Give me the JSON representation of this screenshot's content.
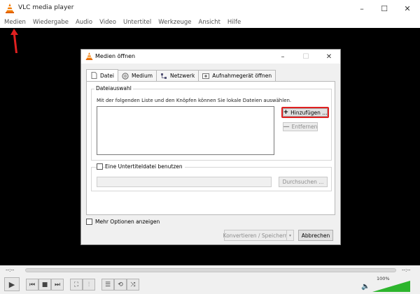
{
  "window": {
    "title": "VLC media player",
    "minimize": "–",
    "maximize": "☐",
    "close": "✕"
  },
  "menu": {
    "items": [
      "Medien",
      "Wiedergabe",
      "Audio",
      "Video",
      "Untertitel",
      "Werkzeuge",
      "Ansicht",
      "Hilfe"
    ]
  },
  "dialog": {
    "title": "Medien öffnen",
    "minimize": "–",
    "maximize": "☐",
    "close": "✕",
    "tabs": [
      {
        "label": "Datei",
        "icon": "file-icon"
      },
      {
        "label": "Medium",
        "icon": "disc-icon"
      },
      {
        "label": "Netzwerk",
        "icon": "network-icon"
      },
      {
        "label": "Aufnahmegerät öffnen",
        "icon": "capture-icon"
      }
    ],
    "file_group": {
      "title": "Dateiauswahl",
      "hint": "Mit der folgenden Liste und den Knöpfen können Sie lokale Dateien auswählen.",
      "add_label": "Hinzufügen ...",
      "remove_label": "Entfernen"
    },
    "subtitle": {
      "checkbox_label": "Eine Untertiteldatei benutzen",
      "browse_label": "Durchsuchen ..."
    },
    "more_options_label": "Mehr Optionen anzeigen",
    "convert_label": "Konvertieren / Speichern",
    "cancel_label": "Abbrechen"
  },
  "player": {
    "time_elapsed": "--:--",
    "time_total": "--:--",
    "volume_label": "100%",
    "volume": 1.0
  }
}
